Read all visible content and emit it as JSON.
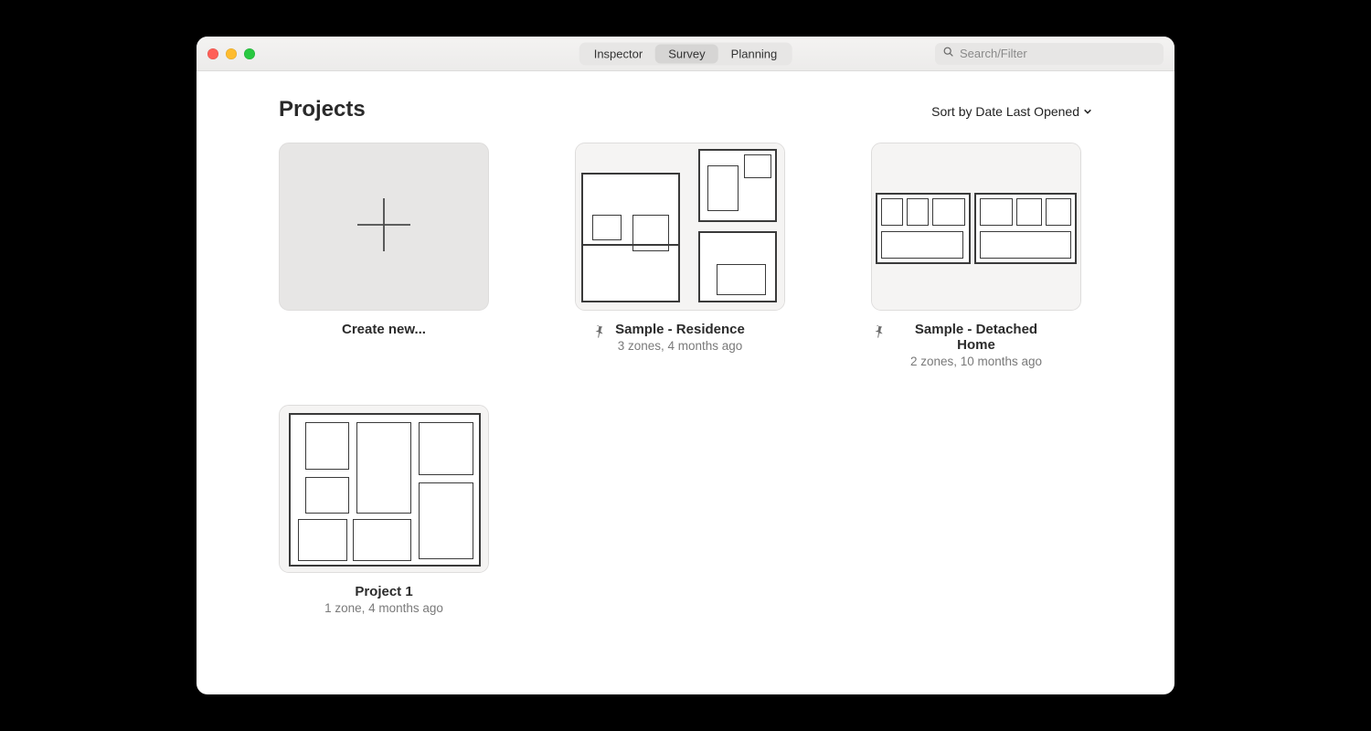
{
  "tabs": {
    "items": [
      "Inspector",
      "Survey",
      "Planning"
    ],
    "active_index": 1
  },
  "search": {
    "placeholder": "Search/Filter"
  },
  "page": {
    "title": "Projects"
  },
  "sort": {
    "label": "Sort by Date Last Opened"
  },
  "create": {
    "label": "Create new..."
  },
  "projects": [
    {
      "title": "Sample - Residence",
      "sub": "3 zones, 4 months ago",
      "pinned": true
    },
    {
      "title": "Sample - Detached Home",
      "sub": "2 zones, 10 months ago",
      "pinned": true
    },
    {
      "title": "Project 1",
      "sub": "1 zone, 4 months ago",
      "pinned": false
    }
  ]
}
